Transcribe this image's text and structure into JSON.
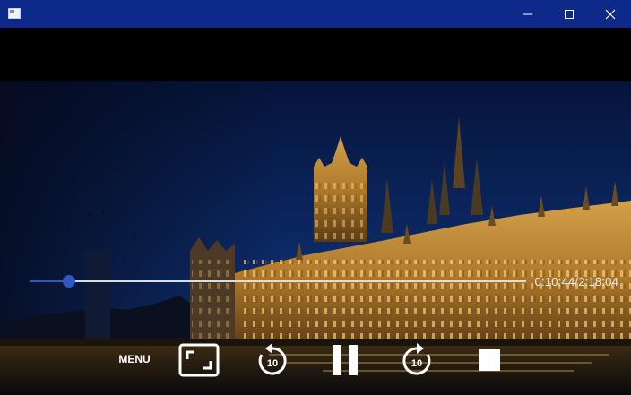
{
  "window": {
    "title": "",
    "icons": {
      "app": "app-window-icon",
      "minimize": "minimize-icon",
      "maximize": "maximize-icon",
      "close": "close-icon"
    },
    "colors": {
      "titlebar": "#0d2a8a"
    }
  },
  "player": {
    "progress": {
      "elapsed_fraction": 0.079,
      "time_label": "0:10:44/2:18:04"
    },
    "controls": {
      "menu_label": "MENU",
      "rewind_seconds": "10",
      "forward_seconds": "10",
      "icons": {
        "fullscreen": "fullscreen-icon",
        "rewind": "rewind-10-icon",
        "pause": "pause-icon",
        "forward": "forward-10-icon",
        "stop": "stop-icon"
      }
    },
    "colors": {
      "accent": "#2f57c6",
      "track": "#d9dde6"
    }
  }
}
